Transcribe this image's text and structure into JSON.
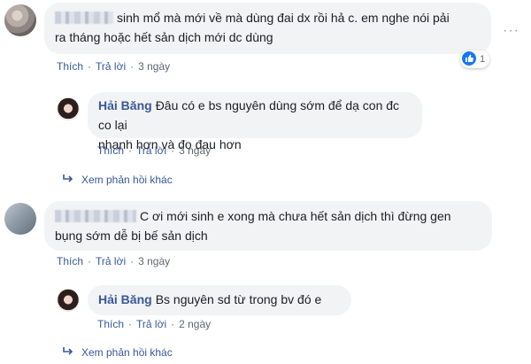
{
  "comments": [
    {
      "author_blurred": true,
      "text_line1": "sinh mổ mà mới về mà dùng đai dx rồi hả c. em nghe nói pải",
      "text_line2": "ra tháng hoặc hết sản dịch mới dc dùng",
      "like_label": "Thích",
      "reply_label": "Trả lời",
      "time": "3 ngày",
      "reaction_count": "1",
      "reaction_icon": "like-icon",
      "reply": {
        "author": "Hải Băng",
        "text_line1": "Đâu có e bs nguyên dùng sớm để dạ con đc co lại",
        "text_line2": "nhanh hơn và đo đau hơn",
        "like_label": "Thích",
        "reply_label": "Trả lời",
        "time": "3 ngày"
      },
      "more_replies": "Xem phản hồi khác"
    },
    {
      "author_blurred": true,
      "text_line1": "C ơi mới sinh e xong mà chưa hết sản dịch thì đừng gen",
      "text_line2": "bụng sớm dễ bị bế sản dịch",
      "like_label": "Thích",
      "reply_label": "Trả lời",
      "time": "3 ngày",
      "reply": {
        "author": "Hải Băng",
        "text_line1": "Bs nguyên sd từ trong bv đó e",
        "like_label": "Thích",
        "reply_label": "Trả lời",
        "time": "2 ngày"
      },
      "more_replies": "Xem phản hồi khác"
    }
  ],
  "menu_icon": "more-options-icon",
  "colors": {
    "link": "#385898",
    "bubble": "#f2f3f5",
    "meta": "#606770",
    "like": "#1877f2"
  }
}
